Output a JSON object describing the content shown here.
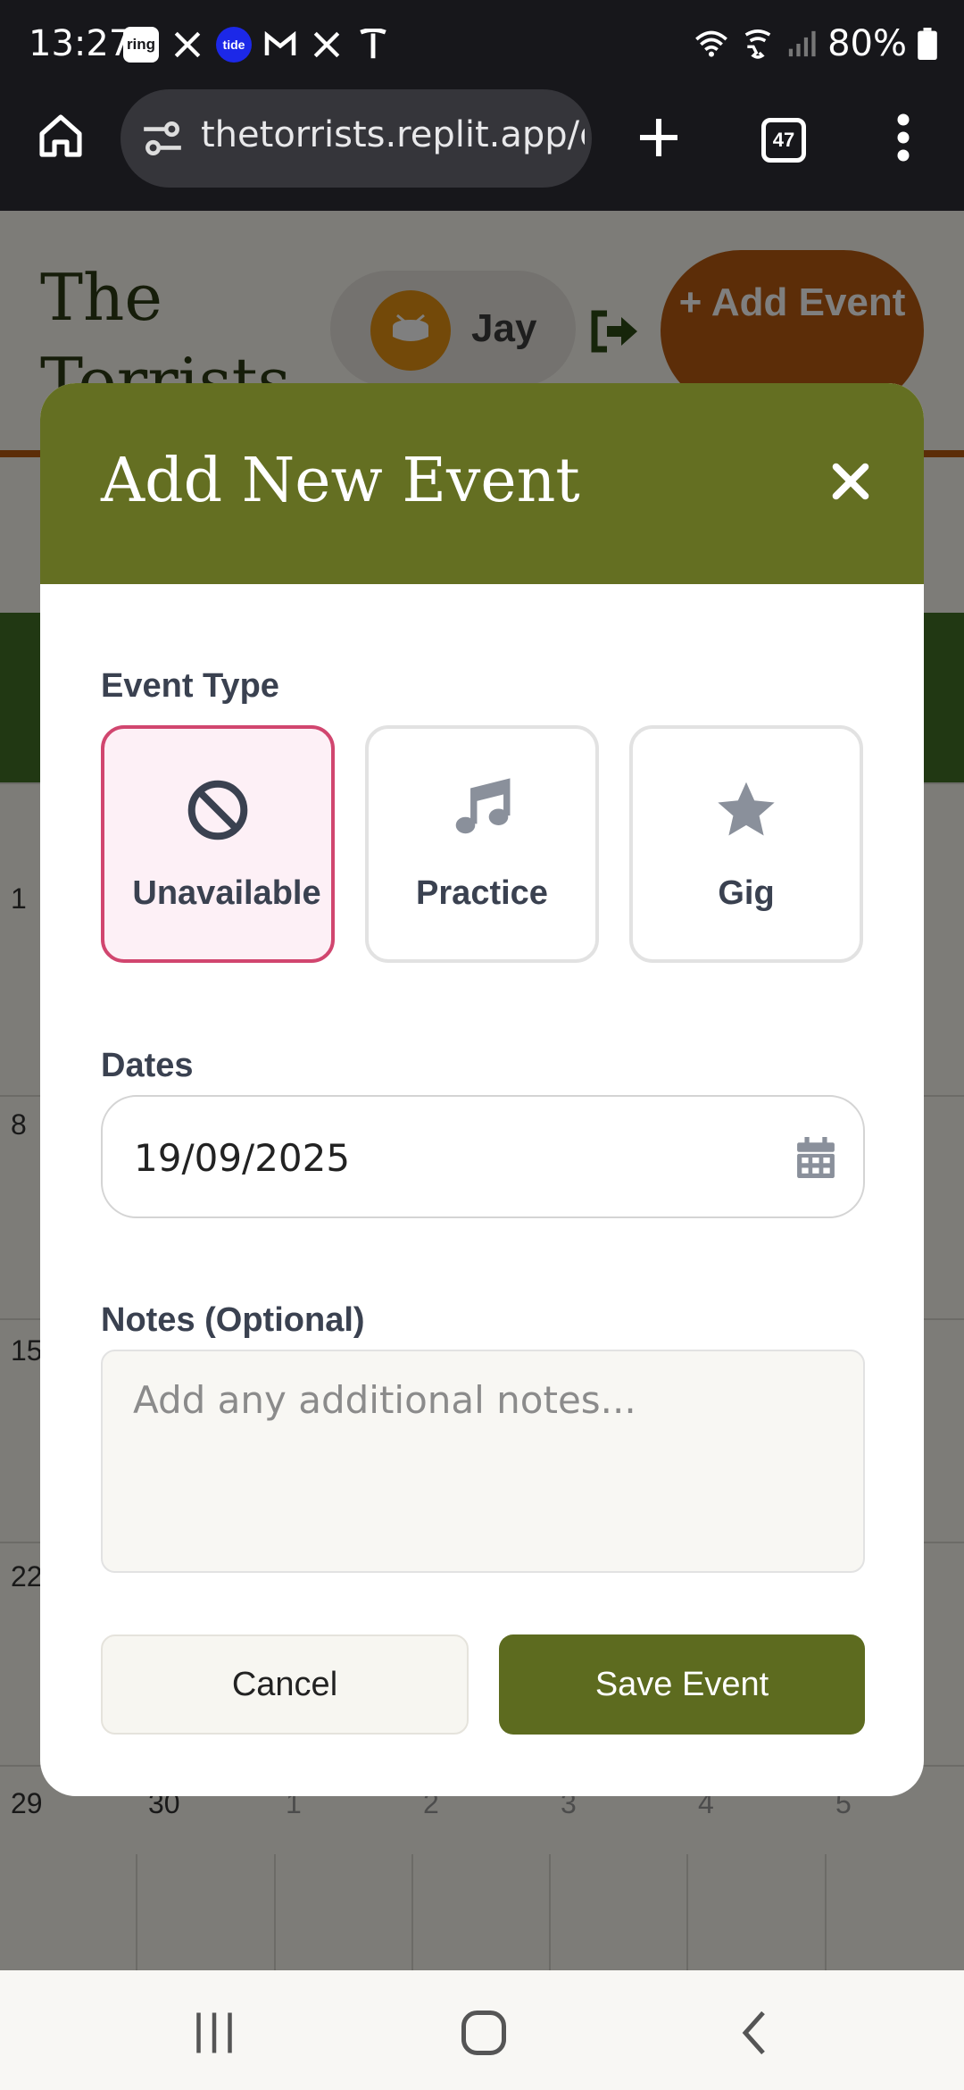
{
  "status_bar": {
    "time": "13:27",
    "notifications": [
      "ring",
      "x-logo",
      "tide",
      "gmail",
      "x-logo",
      "tesla"
    ],
    "ring_label": "ring",
    "tide_label": "tide",
    "battery": "80%"
  },
  "browser": {
    "url": "thetorrists.replit.app/c",
    "tab_count": "47"
  },
  "app": {
    "title": "The Torrists",
    "user_name": "Jay",
    "add_button_label": "+ Add Event"
  },
  "calendar": {
    "visible_numbers": [
      "1",
      "8",
      "15",
      "22",
      "29",
      "30",
      "1",
      "2",
      "3",
      "4",
      "5"
    ]
  },
  "modal": {
    "title": "Add New Event",
    "event_type_label": "Event Type",
    "event_types": [
      {
        "label": "Unavailable",
        "icon": "ban-icon",
        "selected": true
      },
      {
        "label": "Practice",
        "icon": "music-note-icon",
        "selected": false
      },
      {
        "label": "Gig",
        "icon": "star-icon",
        "selected": false
      }
    ],
    "dates_label": "Dates",
    "date_value": "19/09/2025",
    "notes_label": "Notes (Optional)",
    "notes_placeholder": "Add any additional notes...",
    "cancel_label": "Cancel",
    "save_label": "Save Event"
  },
  "colors": {
    "modal_header": "#646f22",
    "save_button": "#5d6b1f",
    "selected_border": "#d1466f",
    "selected_bg": "#fdf0f6",
    "add_event_button": "#b95b10"
  }
}
